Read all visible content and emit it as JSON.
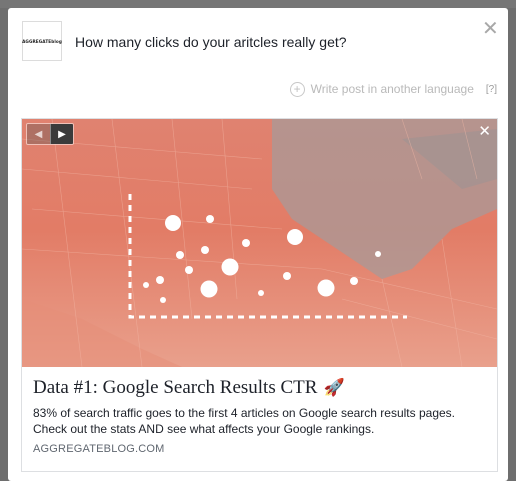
{
  "composer": {
    "logo_text": "AGGREGATEblog",
    "post_text": "How many clicks do your aritcles really get?",
    "close_icon": "close-icon",
    "write_lang_label": "Write post in another language",
    "help_label": "[?]"
  },
  "link_card": {
    "title": "Data #1: Google Search Results CTR",
    "title_emoji": "🚀",
    "description": "83% of search traffic goes to the first 4 articles on Google search results pages. Check out the stats AND see what affects your Google rankings.",
    "domain": "AGGREGATEBLOG.COM",
    "carousel_prev_icon": "chevron-left-icon",
    "carousel_next_icon": "chevron-right-icon",
    "remove_icon": "close-icon"
  },
  "colors": {
    "image_tint": "#e27c66",
    "text_primary": "#1d2129",
    "text_muted": "#606770",
    "overlay": "#6e6e6e"
  }
}
